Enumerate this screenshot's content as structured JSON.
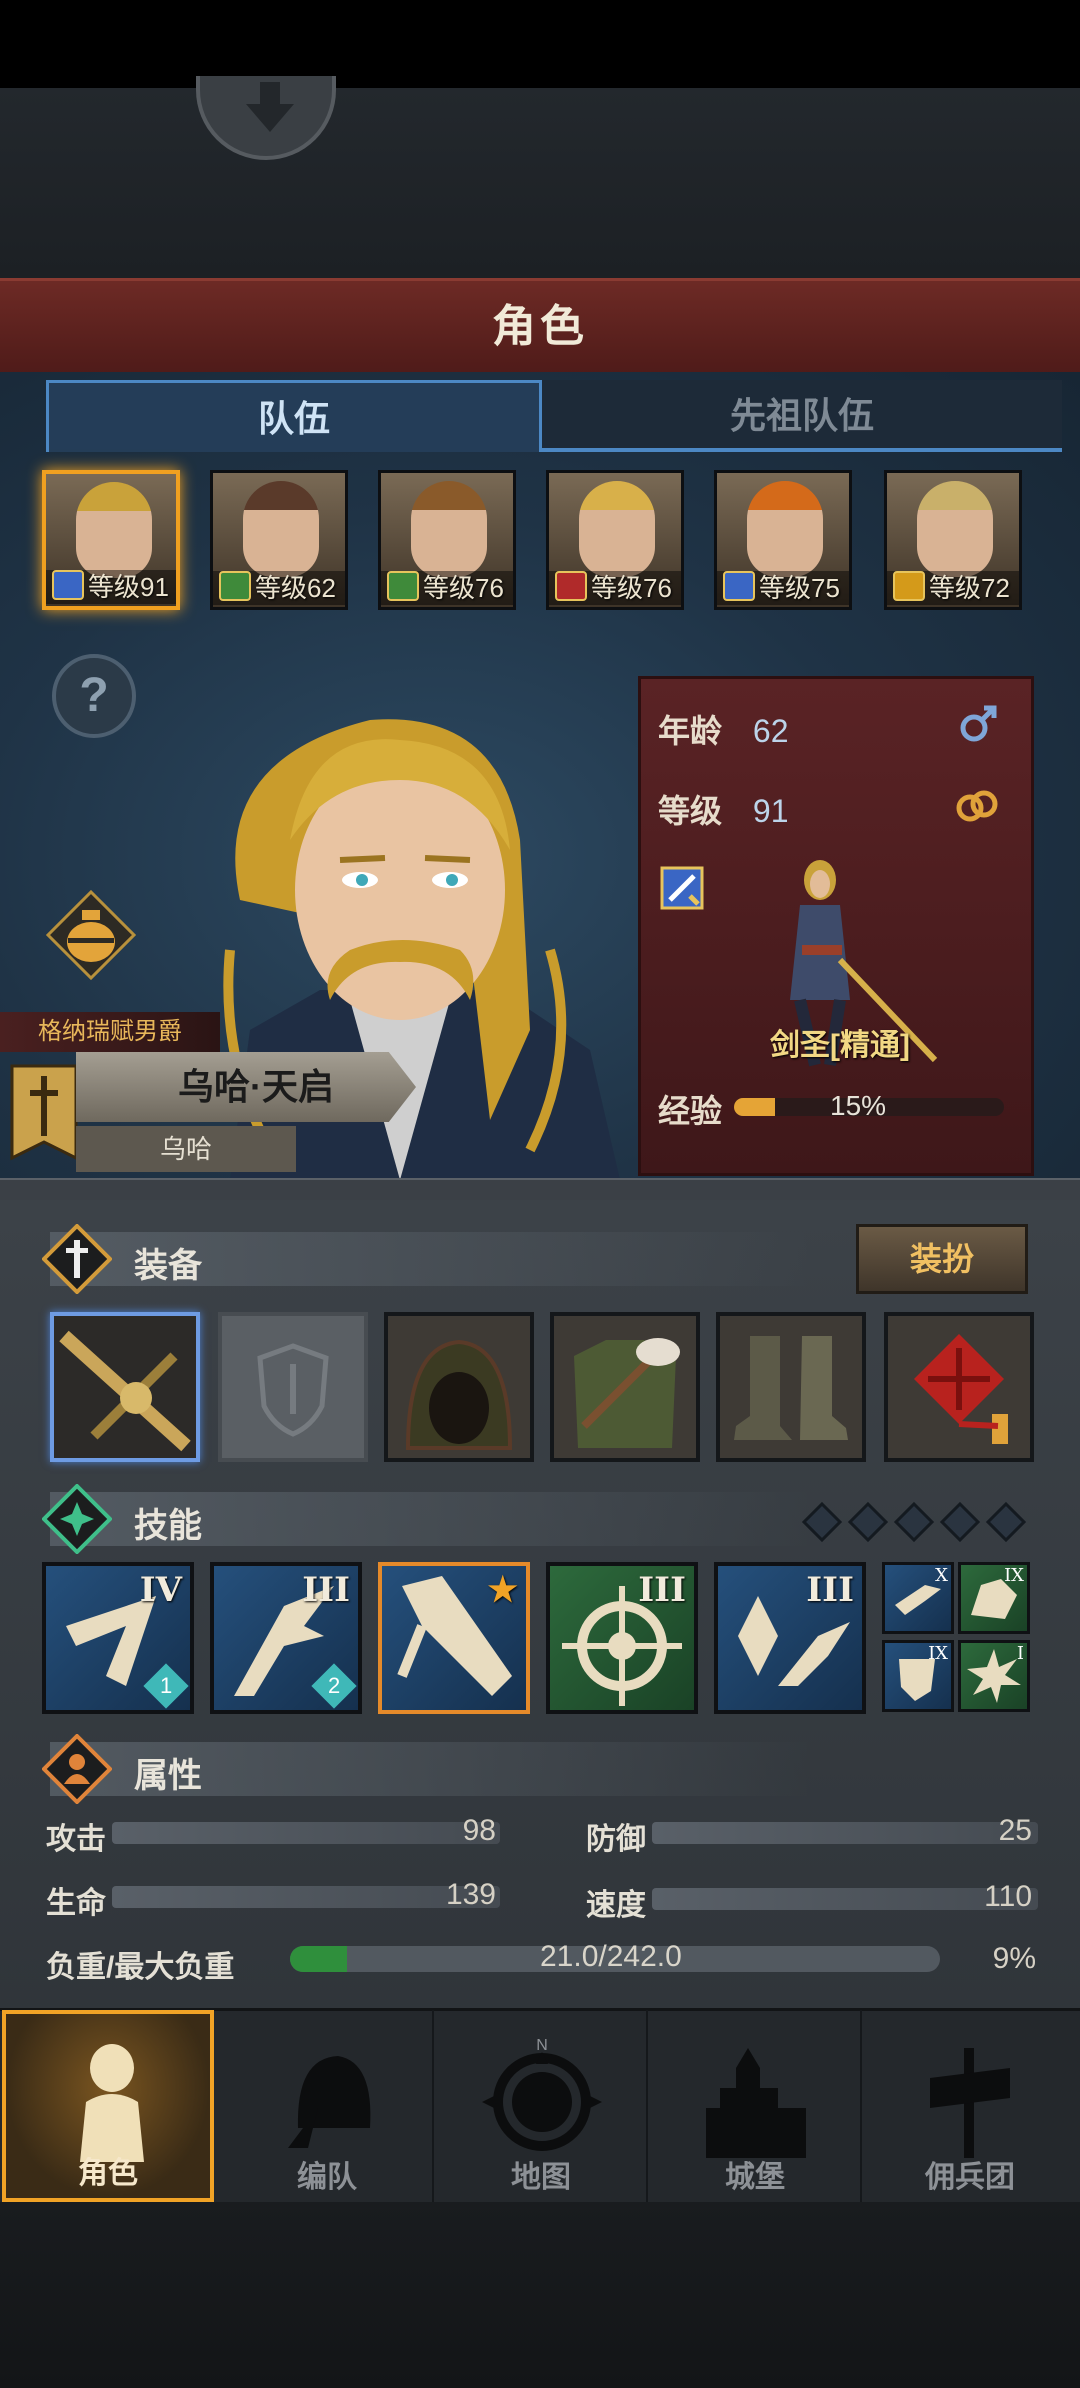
{
  "title": "角色",
  "tabs": [
    {
      "label": "队伍",
      "active": true
    },
    {
      "label": "先祖队伍",
      "active": false
    }
  ],
  "team": [
    {
      "level": "等级91",
      "selected": true,
      "hair": "#c9a23a",
      "class_color": "#3a66c4"
    },
    {
      "level": "等级62",
      "selected": false,
      "hair": "#5a3a2a",
      "class_color": "#3f8a3a"
    },
    {
      "level": "等级76",
      "selected": false,
      "hair": "#8a5a2a",
      "class_color": "#3f8a3a"
    },
    {
      "level": "等级76",
      "selected": false,
      "hair": "#d8b04a",
      "class_color": "#b02a2a"
    },
    {
      "level": "等级75",
      "selected": false,
      "hair": "#d46a1a",
      "class_color": "#3a66c4"
    },
    {
      "level": "等级72",
      "selected": false,
      "hair": "#c9b06a",
      "class_color": "#d49a1a"
    }
  ],
  "hero": {
    "title": "格纳瑞赋男爵",
    "name": "乌哈·天启",
    "short_name": "乌哈"
  },
  "info": {
    "age_label": "年龄",
    "age": "62",
    "level_label": "等级",
    "level": "91",
    "class_name": "剑圣[精通]",
    "exp_label": "经验",
    "exp_percent_text": "15%",
    "exp_fraction": 0.15
  },
  "equipment": {
    "title": "装备",
    "dress_button": "装扮",
    "slots": [
      "sword",
      "shield",
      "hood",
      "armor",
      "boots",
      "charm"
    ]
  },
  "skills": {
    "title": "技能",
    "large": [
      {
        "rank": "IV",
        "badge": "1"
      },
      {
        "rank": "III",
        "badge": "2"
      },
      {
        "rank": "★",
        "badge": ""
      },
      {
        "rank": "III",
        "badge": ""
      },
      {
        "rank": "III",
        "badge": ""
      }
    ],
    "mini": [
      {
        "rank": "X"
      },
      {
        "rank": "IX"
      },
      {
        "rank": "IX"
      },
      {
        "rank": "I"
      }
    ]
  },
  "attributes": {
    "title": "属性",
    "attack_label": "攻击",
    "attack": "98",
    "defense_label": "防御",
    "defense": "25",
    "hp_label": "生命",
    "hp": "139",
    "speed_label": "速度",
    "speed": "110",
    "load_label": "负重/最大负重",
    "load_text": "21.0/242.0",
    "load_percent_text": "9%",
    "load_fraction": 0.087
  },
  "nav": [
    {
      "label": "角色",
      "active": true
    },
    {
      "label": "编队",
      "active": false
    },
    {
      "label": "地图",
      "active": false
    },
    {
      "label": "城堡",
      "active": false
    },
    {
      "label": "佣兵团",
      "active": false
    }
  ],
  "compass_letter": "N"
}
